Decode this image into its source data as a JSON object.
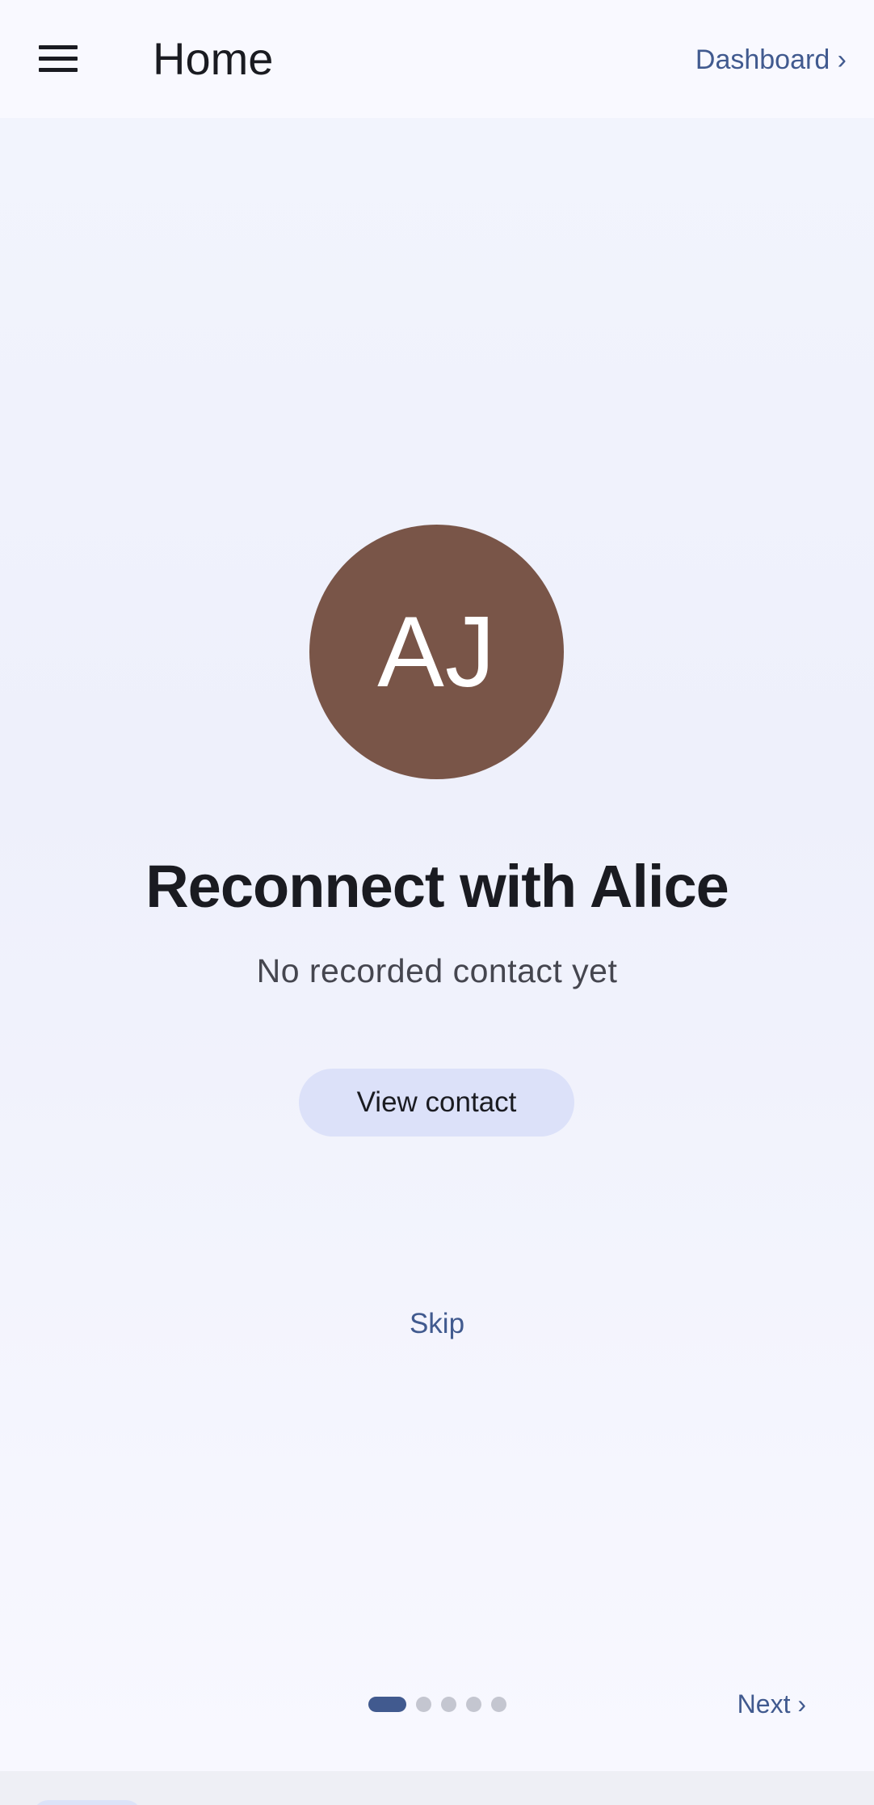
{
  "header": {
    "title": "Home",
    "menu_icon": "hamburger-menu-icon",
    "dashboard_link": "Dashboard ›"
  },
  "card": {
    "avatar_initials": "AJ",
    "avatar_color": "#795548",
    "headline": "Reconnect with Alice",
    "subtext": "No recorded contact yet",
    "primary_button": "View contact",
    "secondary_button": "Skip"
  },
  "pager": {
    "total_pages": 5,
    "current_page": 1,
    "next_label": "Next ›"
  },
  "colors": {
    "accent": "#415a8f",
    "button_bg": "#dce1f9",
    "text_primary": "#1a1b21",
    "text_secondary": "#45464f",
    "dot_inactive": "#c4c6d0"
  }
}
